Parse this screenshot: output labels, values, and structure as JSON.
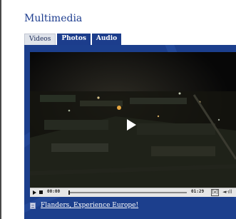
{
  "widget": {
    "title": "Multimedia",
    "tabs": [
      {
        "label": "Videos",
        "active": true
      },
      {
        "label": "Photos",
        "active": false
      },
      {
        "label": "Audio",
        "active": false
      }
    ]
  },
  "player": {
    "current_time": "00:00",
    "total_time": "01:29",
    "progress": 0,
    "fullscreen_glyph": "[x]",
    "volume_glyph": "◄·ıll"
  },
  "caption": {
    "link_text": "Flanders, Experience Europe!"
  },
  "colors": {
    "title": "#1d3d8f",
    "panel_bg": "#1c3f8d",
    "tab_active_bg": "#dfe3ea",
    "tab_inactive_bg": "#1c3d8c",
    "controls_bg": "#e6e6e6"
  },
  "icons": [
    "play-icon",
    "stop-icon",
    "fullscreen-icon",
    "volume-icon",
    "document-icon"
  ]
}
